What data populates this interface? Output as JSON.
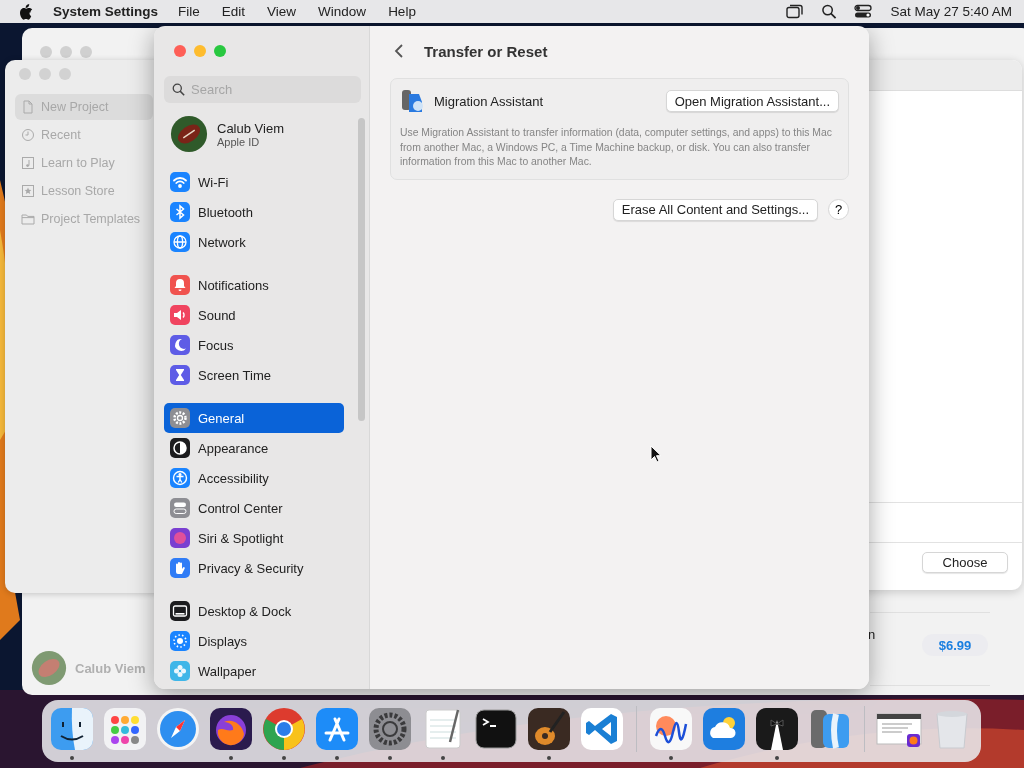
{
  "menubar": {
    "app_name": "System Settings",
    "menus": [
      "File",
      "Edit",
      "View",
      "Window",
      "Help"
    ],
    "clock": "Sat May 27  5:40 AM"
  },
  "background": {
    "sidebar_items": [
      {
        "label": "New Project",
        "selected": true
      },
      {
        "label": "Recent",
        "selected": false
      },
      {
        "label": "Learn to Play",
        "selected": false
      },
      {
        "label": "Lesson Store",
        "selected": false
      },
      {
        "label": "Project Templates",
        "selected": false
      }
    ],
    "account_name": "Calub Viem",
    "choose_button": "Choose",
    "row_fragment": "n",
    "price": "$6.99"
  },
  "settings": {
    "search_placeholder": "Search",
    "account": {
      "name": "Calub Viem",
      "subtitle": "Apple ID"
    },
    "groups": [
      [
        {
          "label": "Wi-Fi",
          "color": "#1a84ff",
          "selected": false
        },
        {
          "label": "Bluetooth",
          "color": "#1a84ff",
          "selected": false
        },
        {
          "label": "Network",
          "color": "#1a84ff",
          "selected": false
        }
      ],
      [
        {
          "label": "Notifications",
          "color": "#f0534f",
          "selected": false
        },
        {
          "label": "Sound",
          "color": "#f0445f",
          "selected": false
        },
        {
          "label": "Focus",
          "color": "#5e5ce6",
          "selected": false
        },
        {
          "label": "Screen Time",
          "color": "#5e5ce6",
          "selected": false
        }
      ],
      [
        {
          "label": "General",
          "color": "#8e8e93",
          "selected": true
        },
        {
          "label": "Appearance",
          "color": "#1c1c1e",
          "selected": false
        },
        {
          "label": "Accessibility",
          "color": "#1a84ff",
          "selected": false
        },
        {
          "label": "Control Center",
          "color": "#8e8e93",
          "selected": false
        },
        {
          "label": "Siri & Spotlight",
          "color": "#7a3fd1",
          "selected": false
        },
        {
          "label": "Privacy & Security",
          "color": "#2f7cf6",
          "selected": false
        }
      ],
      [
        {
          "label": "Desktop & Dock",
          "color": "#1c1c1e",
          "selected": false
        },
        {
          "label": "Displays",
          "color": "#1a84ff",
          "selected": false
        },
        {
          "label": "Wallpaper",
          "color": "#3fb6e8",
          "selected": false
        }
      ]
    ],
    "page": {
      "title": "Transfer or Reset",
      "migration_title": "Migration Assistant",
      "migration_button": "Open Migration Assistant...",
      "migration_description": "Use Migration Assistant to transfer information (data, computer settings, and apps) to this Mac from another Mac, a Windows PC, a Time Machine backup, or disk. You can also transfer information from this Mac to another Mac.",
      "erase_button": "Erase All Content and Settings...",
      "help_button": "?"
    }
  },
  "dock": {
    "apps": [
      {
        "kind": "finder",
        "running": true
      },
      {
        "kind": "launchpad",
        "running": false
      },
      {
        "kind": "compass",
        "running": false
      },
      {
        "kind": "fox",
        "running": true
      },
      {
        "kind": "ring",
        "running": true
      },
      {
        "kind": "appstore",
        "running": true
      },
      {
        "kind": "gear",
        "running": true
      },
      {
        "kind": "notepad",
        "running": true
      },
      {
        "kind": "terminal",
        "running": false
      },
      {
        "kind": "guitar",
        "running": true
      },
      {
        "kind": "ribbon",
        "running": false
      },
      {
        "kind": "separator"
      },
      {
        "kind": "squiggle",
        "running": true
      },
      {
        "kind": "weather",
        "running": false
      },
      {
        "kind": "tuxedo",
        "running": true
      },
      {
        "kind": "migration",
        "running": false
      },
      {
        "kind": "separator"
      },
      {
        "kind": "window",
        "running": false
      },
      {
        "kind": "trash",
        "running": false
      }
    ]
  }
}
